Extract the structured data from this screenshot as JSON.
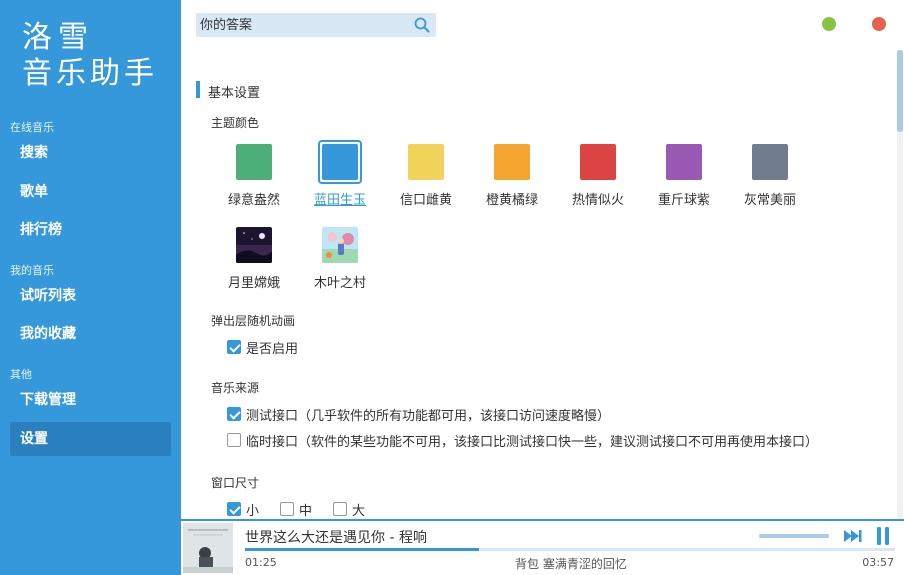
{
  "app": {
    "logo_line1": "洛雪",
    "logo_line2": "音乐助手",
    "accent": "#3498db"
  },
  "sidebar": {
    "groups": [
      {
        "title": "在线音乐",
        "items": [
          {
            "label": "搜索"
          },
          {
            "label": "歌单"
          },
          {
            "label": "排行榜"
          }
        ]
      },
      {
        "title": "我的音乐",
        "items": [
          {
            "label": "试听列表"
          },
          {
            "label": "我的收藏"
          }
        ]
      },
      {
        "title": "其他",
        "items": [
          {
            "label": "下载管理"
          },
          {
            "label": "设置",
            "active": true
          }
        ]
      }
    ]
  },
  "search": {
    "placeholder": "你的答案",
    "icon": "search-icon"
  },
  "window_controls": {
    "minimize_color": "#85c440",
    "close_color": "#e2654b"
  },
  "settings": {
    "section_title": "基本设置",
    "theme_label": "主题颜色",
    "themes": [
      {
        "name": "绿意盎然",
        "color": "#4caf7a"
      },
      {
        "name": "蓝田生玉",
        "color": "#3498db",
        "active": true
      },
      {
        "name": "信口雌黄",
        "color": "#f1d35a"
      },
      {
        "name": "橙黄橘绿",
        "color": "#f5a631"
      },
      {
        "name": "热情似火",
        "color": "#dc4343"
      },
      {
        "name": "重斤球紫",
        "color": "#9b59b6"
      },
      {
        "name": "灰常美丽",
        "color": "#6f7d8c"
      },
      {
        "name": "月里嫦娥",
        "color": "#2a1f3d"
      },
      {
        "name": "木叶之村",
        "color": "#7fc8e8"
      }
    ],
    "popup_label": "弹出层随机动画",
    "popup_option": "是否启用",
    "popup_checked": true,
    "source_label": "音乐来源",
    "sources": [
      {
        "label": "测试接口（几乎软件的所有功能都可用，该接口访问速度略慢）",
        "checked": true
      },
      {
        "label": "临时接口（软件的某些功能不可用，该接口比测试接口快一些，建议测试接口不可用再使用本接口）",
        "checked": false
      }
    ],
    "window_size_label": "窗口尺寸",
    "sizes": [
      {
        "label": "小",
        "checked": true
      },
      {
        "label": "中",
        "checked": false
      },
      {
        "label": "大",
        "checked": false
      }
    ]
  },
  "player": {
    "song_title": "世界这么大还是遇见你 - 程响",
    "current_time": "01:25",
    "total_time": "03:57",
    "progress_fraction": 0.36,
    "lyric": "背包 塞满青涩的回忆"
  }
}
